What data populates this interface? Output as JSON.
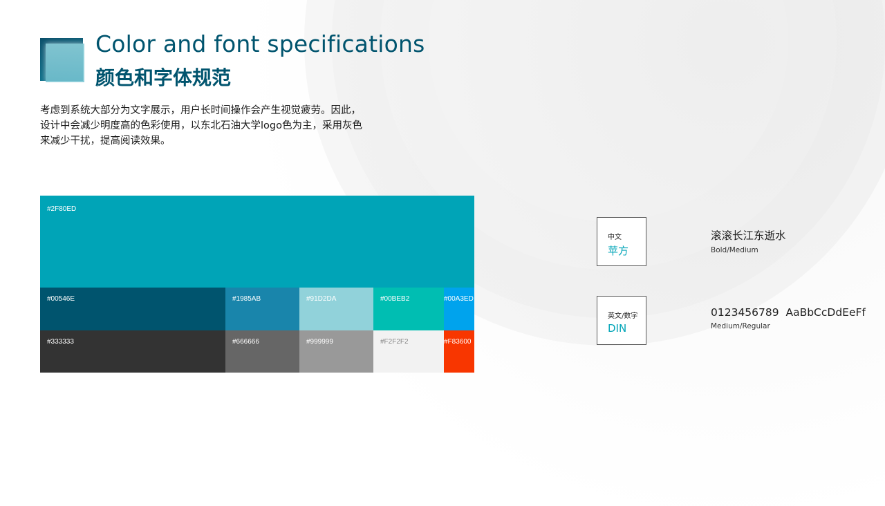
{
  "header": {
    "title_en": "Color and font specifications",
    "title_zh": "颜色和字体规范"
  },
  "description": {
    "lines": [
      "考虑到系统大部分为文字展示，用户长时间操作会产生视觉疲劳。因此，",
      "设计中会减少明度高的色彩使用，以东北石油大学logo色为主，采用灰色",
      "来减少干扰，提高阅读效果。"
    ]
  },
  "palette": {
    "primary": {
      "code": "#2F80ED",
      "color": "#00A4B7"
    },
    "row1": [
      {
        "code": "#00546E",
        "color": "#00546E"
      },
      {
        "code": "#1985AB",
        "color": "#1985AB"
      },
      {
        "code": "#91D2DA",
        "color": "#91D2DA"
      },
      {
        "code": "#00BEB2",
        "color": "#00BEB2"
      },
      {
        "code": "#00A3ED",
        "color": "#00A3ED"
      }
    ],
    "row2": [
      {
        "code": "#333333",
        "color": "#333333"
      },
      {
        "code": "#666666",
        "color": "#666666"
      },
      {
        "code": "#999999",
        "color": "#999999"
      },
      {
        "code": "#F2F2F2",
        "color": "#F2F2F2"
      },
      {
        "code": "#F83600",
        "color": "#F83600"
      }
    ]
  },
  "fonts": {
    "chinese": {
      "label": "中文",
      "font_name": "苹方",
      "sample": "滚滚长江东逝水",
      "weights": "Bold/Medium"
    },
    "english": {
      "label": "英文/数字",
      "font_name": "DIN",
      "sample": "0123456789  AaBbCcDdEeFf",
      "weights": "Medium/Regular"
    }
  },
  "colors": {
    "accent": "#00546E",
    "font_name_accent": "#00A4B7"
  }
}
